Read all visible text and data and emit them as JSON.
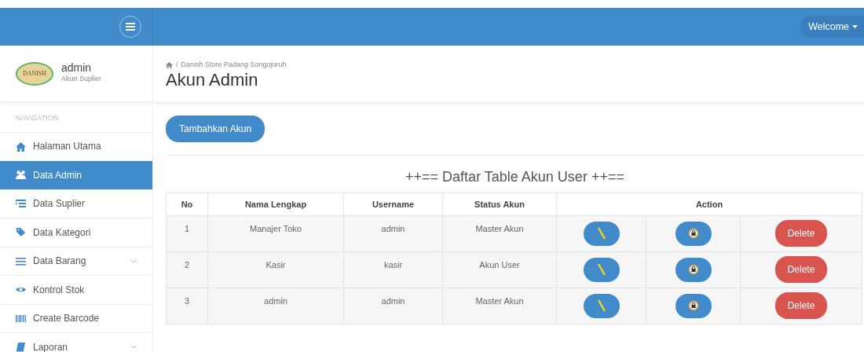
{
  "header": {
    "user_menu": "Welcome"
  },
  "user_panel": {
    "logo_text": "DANISH",
    "name": "admin",
    "role": "Akun Suplier"
  },
  "sidebar": {
    "heading": "NAVIGATION",
    "items": [
      {
        "label": "Halaman Utama",
        "selected": false,
        "has_submenu": false
      },
      {
        "label": "Data Admin",
        "selected": true,
        "has_submenu": false
      },
      {
        "label": "Data Suplier",
        "selected": false,
        "has_submenu": false
      },
      {
        "label": "Data Kategori",
        "selected": false,
        "has_submenu": false
      },
      {
        "label": "Data Barang",
        "selected": false,
        "has_submenu": true
      },
      {
        "label": "Kontrol Stok",
        "selected": false,
        "has_submenu": false
      },
      {
        "label": "Create Barcode",
        "selected": false,
        "has_submenu": false
      },
      {
        "label": "Laporan",
        "selected": false,
        "has_submenu": true
      }
    ]
  },
  "breadcrumb": {
    "separator": "/",
    "items": [
      "Danish Store Padang Songojuruh"
    ]
  },
  "page_title": "Akun Admin",
  "add_button": "Tambahkan Akun",
  "table": {
    "title": "++== Daftar Table Akun User ++==",
    "columns": [
      "No",
      "Nama Lengkap",
      "Username",
      "Status Akun",
      "Action"
    ],
    "rows": [
      {
        "no": "1",
        "name": "Manajer Toko",
        "username": "admin",
        "status": "Master Akun",
        "delete": "Delete"
      },
      {
        "no": "2",
        "name": "Kasir",
        "username": "kasir",
        "status": "Akun User",
        "delete": "Delete"
      },
      {
        "no": "3",
        "name": "admin",
        "username": "admin",
        "status": "Master Akun",
        "delete": "Delete"
      }
    ]
  }
}
